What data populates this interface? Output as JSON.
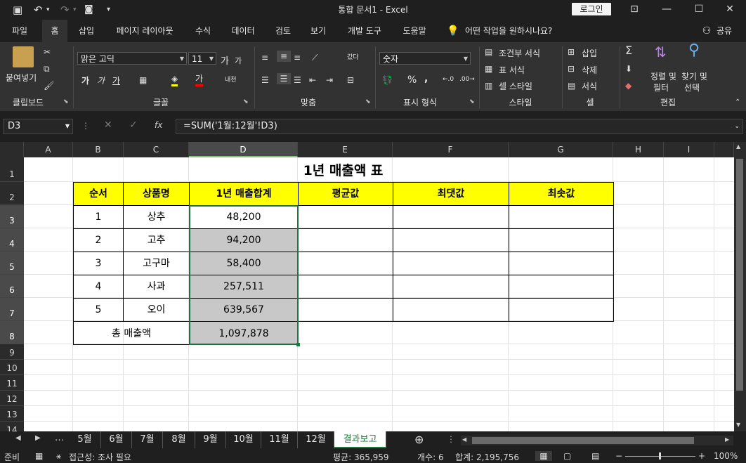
{
  "window": {
    "title": "통합 문서1  -  Excel",
    "login": "로그인",
    "buttons": {
      "ribbon_display": "⊡",
      "minimize": "—",
      "maximize": "☐",
      "close": "✕"
    }
  },
  "quick_access": {
    "save": "💾",
    "undo": "↶",
    "redo": "↷",
    "camera": "📷",
    "more": "▾"
  },
  "tabs": [
    {
      "label": "파일"
    },
    {
      "label": "홈"
    },
    {
      "label": "삽입"
    },
    {
      "label": "페이지 레이아웃"
    },
    {
      "label": "수식"
    },
    {
      "label": "데이터"
    },
    {
      "label": "검토"
    },
    {
      "label": "보기"
    },
    {
      "label": "개발 도구"
    },
    {
      "label": "도움말"
    }
  ],
  "tell_me": "어떤 작업을 원하시나요?",
  "share": "공유",
  "ribbon": {
    "clipboard": {
      "paste": "붙여넣기",
      "label": "클립보드"
    },
    "font": {
      "name": "맑은 고딕",
      "size": "11",
      "label": "글꼴",
      "bold": "가",
      "italic": "가",
      "underline": "가",
      "grow": "가",
      "shrink": "가",
      "phonetic": "내천"
    },
    "alignment": {
      "label": "맞춤",
      "wrap": "갔다"
    },
    "number": {
      "format": "숫자",
      "label": "표시 형식",
      "percent": "%",
      "comma": ","
    },
    "styles": {
      "conditional": "조건부 서식",
      "table": "표 서식",
      "cell": "셀 스타일",
      "label": "스타일"
    },
    "cells": {
      "insert": "삽입",
      "delete": "삭제",
      "format": "서식",
      "label": "셀"
    },
    "editing": {
      "sort_top": "정렬 및",
      "sort_bottom": "필터",
      "find_top": "찾기 및",
      "find_bottom": "선택",
      "label": "편집"
    }
  },
  "formula_bar": {
    "name_box": "D3",
    "formula": "=SUM('1월:12월'!D3)",
    "fx": "fx"
  },
  "columns": [
    "A",
    "B",
    "C",
    "D",
    "E",
    "F",
    "G",
    "H",
    "I"
  ],
  "rows": [
    "1",
    "2",
    "3",
    "4",
    "5",
    "6",
    "7",
    "8",
    "9",
    "10",
    "11",
    "12",
    "13",
    "14"
  ],
  "table": {
    "title": "1년 매출액 표",
    "headers": [
      "순서",
      "상품명",
      "1년 매출합계",
      "평균값",
      "최댓값",
      "최솟값"
    ],
    "rows": [
      [
        "1",
        "상추",
        "48,200"
      ],
      [
        "2",
        "고추",
        "94,200"
      ],
      [
        "3",
        "고구마",
        "58,400"
      ],
      [
        "4",
        "사과",
        "257,511"
      ],
      [
        "5",
        "오이",
        "639,567"
      ]
    ],
    "total_label": "총 매출액",
    "total_value": "1,097,878"
  },
  "sheet_tabs": [
    "5월",
    "6월",
    "7월",
    "8월",
    "9월",
    "10월",
    "11월",
    "12월",
    "결과보고"
  ],
  "active_sheet": "결과보고",
  "status": {
    "ready": "준비",
    "accessibility": "접근성: 조사 필요",
    "average": "평균: 365,959",
    "count": "개수: 6",
    "sum": "합계: 2,195,756",
    "zoom": "100%"
  },
  "colors": {
    "header_fill": "#ffff00",
    "selection_fill": "#c8c8c8",
    "selection_border": "#217346"
  }
}
